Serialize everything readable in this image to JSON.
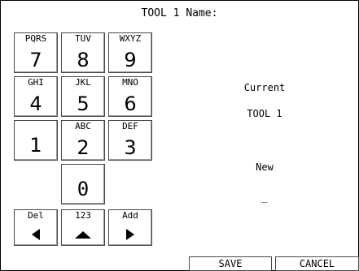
{
  "title": "TOOL 1 Name:",
  "keypad": {
    "k7": {
      "sub": "PQRS",
      "main": "7"
    },
    "k8": {
      "sub": "TUV",
      "main": "8"
    },
    "k9": {
      "sub": "WXYZ",
      "main": "9"
    },
    "k4": {
      "sub": "GHI",
      "main": "4"
    },
    "k5": {
      "sub": "JKL",
      "main": "5"
    },
    "k6": {
      "sub": "MNO",
      "main": "6"
    },
    "k1": {
      "main": "1"
    },
    "k2": {
      "sub": "ABC",
      "main": "2"
    },
    "k3": {
      "sub": "DEF",
      "main": "3"
    },
    "k0": {
      "main": "0"
    },
    "del": {
      "sub": "Del",
      "icon": "left-triangle-icon"
    },
    "mode": {
      "sub": "123",
      "icon": "up-triangle-icon"
    },
    "add": {
      "sub": "Add",
      "icon": "right-triangle-icon"
    }
  },
  "current": {
    "label": "Current",
    "value": "TOOL 1"
  },
  "new": {
    "label": "New",
    "value": "_"
  },
  "buttons": {
    "save": "SAVE",
    "cancel": "CANCEL"
  }
}
